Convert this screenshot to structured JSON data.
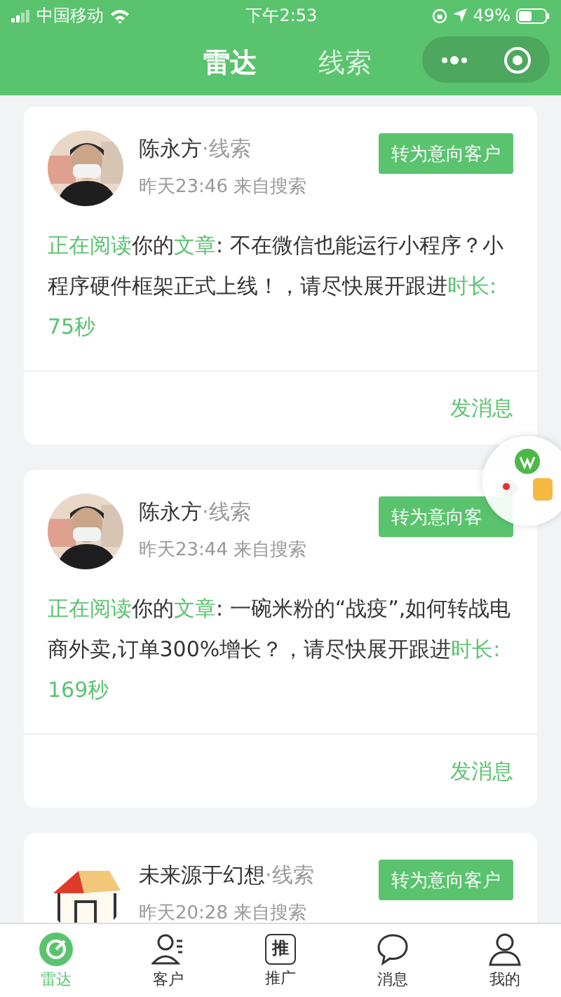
{
  "status_bar": {
    "carrier": "中国移动",
    "time": "下午2:53",
    "battery": "49%"
  },
  "nav_tabs": [
    {
      "label": "雷达",
      "selected": true
    },
    {
      "label": "线索",
      "selected": false
    }
  ],
  "cards": [
    {
      "name": "陈永方",
      "tag": "·线索",
      "meta": "昨天23:46 来自搜索",
      "button": "转为意向客户",
      "message": [
        {
          "text": "正在阅读",
          "highlight": true
        },
        {
          "text": "你的",
          "highlight": false
        },
        {
          "text": "文章",
          "highlight": true
        },
        {
          "text": ": 不在微信也能运行小程序？小程序硬件框架正式上线！，请尽快展开跟进",
          "highlight": false
        },
        {
          "text": "时长: 75秒",
          "highlight": true
        }
      ],
      "action": "发消息"
    },
    {
      "name": "陈永方",
      "tag": "·线索",
      "meta": "昨天23:44 来自搜索",
      "button": "转为意向客",
      "message": [
        {
          "text": "正在阅读",
          "highlight": true
        },
        {
          "text": "你的",
          "highlight": false
        },
        {
          "text": "文章",
          "highlight": true
        },
        {
          "text": ": 一碗米粉的“战疫”,如何转战电商外卖,订单300%增长？，请尽快展开跟进",
          "highlight": false
        },
        {
          "text": "时长: 169秒",
          "highlight": true
        }
      ],
      "action": "发消息"
    },
    {
      "kind": "house",
      "name": "未来源于幻想",
      "tag": "·线索",
      "meta": "昨天20:28 来自搜索",
      "button": "转为意向客户"
    }
  ],
  "tab_bar": [
    {
      "kind": "radar",
      "label": "雷达",
      "selected": true
    },
    {
      "kind": "customer",
      "label": "客户",
      "selected": false
    },
    {
      "kind": "promote",
      "glyph": "推",
      "label": "推广",
      "selected": false
    },
    {
      "kind": "message",
      "label": "消息",
      "selected": false
    },
    {
      "kind": "me",
      "label": "我的",
      "selected": false
    }
  ]
}
